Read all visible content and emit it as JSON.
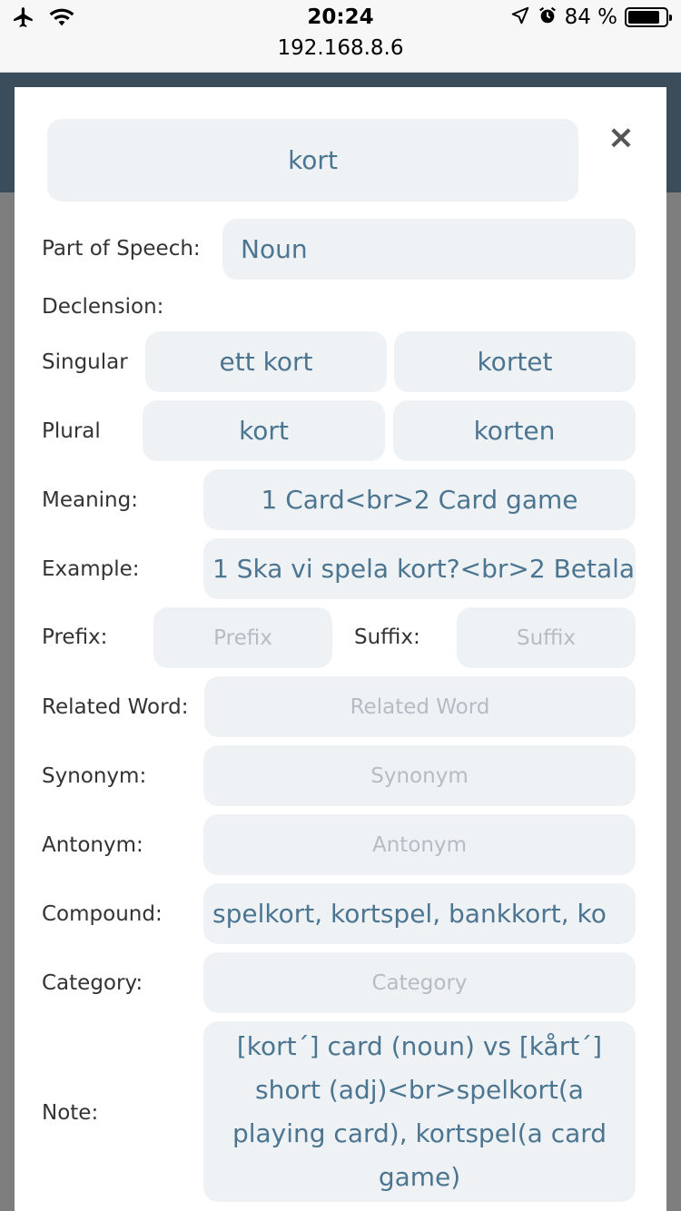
{
  "status": {
    "time": "20:24",
    "url": "192.168.8.6",
    "battery": "84 %",
    "battery_level": 0.84
  },
  "modal": {
    "close_label": "×",
    "word": "kort",
    "labels": {
      "part_of_speech": "Part of Speech:",
      "declension": "Declension:",
      "singular": "Singular",
      "plural": "Plural",
      "meaning": "Meaning:",
      "example": "Example:",
      "prefix": "Prefix:",
      "suffix": "Suffix:",
      "related": "Related Word:",
      "synonym": "Synonym:",
      "antonym": "Antonym:",
      "compound": "Compound:",
      "category": "Category:",
      "note": "Note:"
    },
    "values": {
      "part_of_speech": "Noun",
      "singular_indefinite": "ett kort",
      "singular_definite": "kortet",
      "plural_indefinite": "kort",
      "plural_definite": "korten",
      "meaning": "1 Card<br>2 Card game",
      "example": "1 Ska vi spela kort?<br>2 Betala",
      "compound": "spelkort, kortspel, bankkort, ko",
      "note": "[kort´] card (noun) vs [kårt´] short (adj)<br>spelkort(a playing card), kortspel(a card game)"
    },
    "placeholders": {
      "prefix": "Prefix",
      "suffix": "Suffix",
      "related": "Related Word",
      "synonym": "Synonym",
      "antonym": "Antonym",
      "category": "Category"
    }
  }
}
